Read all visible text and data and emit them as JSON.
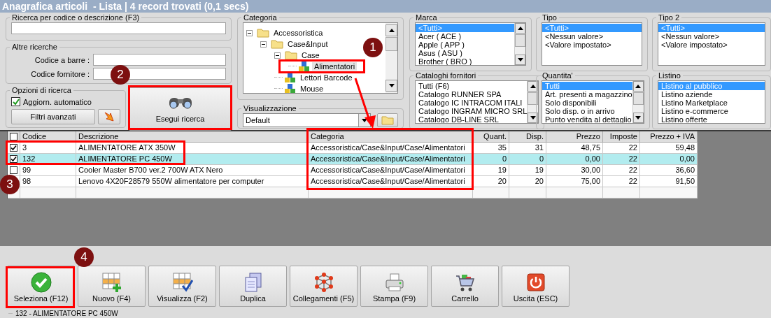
{
  "window": {
    "title": "Anagrafica articoli  - Lista | 4 record trovati (0,1 secs)"
  },
  "search": {
    "title": "Ricerca per codice o descrizione (F3)"
  },
  "other_searches": {
    "title": "Altre ricerche",
    "fields": [
      {
        "label": "Codice a barre :"
      },
      {
        "label": "Codice fornitore :"
      }
    ]
  },
  "options": {
    "title": "Opzioni di ricerca",
    "auto_update": {
      "label": "Aggiorn. automatico",
      "checked": true
    },
    "advanced_button": "Filtri avanzati"
  },
  "search_button": "Esegui ricerca",
  "category": {
    "title": "Categoria",
    "tree": [
      {
        "label": "Accessoristica",
        "kind": "folder",
        "expanded": true,
        "selected": false,
        "children": [
          {
            "label": "Case&Input",
            "kind": "folder",
            "expanded": true,
            "selected": false,
            "children": [
              {
                "label": "Case",
                "kind": "folder",
                "expanded": true,
                "selected": false,
                "children": [
                  {
                    "label": "Alimentatori",
                    "kind": "item",
                    "selected": true
                  }
                ]
              },
              {
                "label": "Lettori Barcode",
                "kind": "item",
                "selected": false
              },
              {
                "label": "Mouse",
                "kind": "item",
                "selected": false
              }
            ]
          }
        ]
      }
    ]
  },
  "view": {
    "title": "Visualizzazione",
    "value": "Default"
  },
  "lists": [
    {
      "title": "Marca",
      "scrollbar": true,
      "items": [
        {
          "label": "<Tutti>",
          "selected": true
        },
        {
          "label": "Acer ( ACE )",
          "selected": false
        },
        {
          "label": "Apple ( APP )",
          "selected": false
        },
        {
          "label": "Asus ( ASU )",
          "selected": false
        },
        {
          "label": "Brother ( BRO )",
          "selected": false
        }
      ]
    },
    {
      "title": "Tipo",
      "scrollbar": false,
      "items": [
        {
          "label": "<Tutti>",
          "selected": true
        },
        {
          "label": "<Nessun valore>",
          "selected": false
        },
        {
          "label": "<Valore impostato>",
          "selected": false
        }
      ]
    },
    {
      "title": "Tipo 2",
      "scrollbar": false,
      "items": [
        {
          "label": "<Tutti>",
          "selected": true
        },
        {
          "label": "<Nessun valore>",
          "selected": false
        },
        {
          "label": "<Valore impostato>",
          "selected": false
        }
      ]
    },
    {
      "title": "Cataloghi fornitori",
      "scrollbar": true,
      "items": [
        {
          "label": "Tutti (F6)",
          "selected": false
        },
        {
          "label": "Catalogo RUNNER SPA",
          "selected": false
        },
        {
          "label": "Catalogo IC INTRACOM ITALI",
          "selected": false
        },
        {
          "label": "Catalogo INGRAM MICRO SRL",
          "selected": false
        },
        {
          "label": "Catalogo DB-LINE SRL",
          "selected": false
        }
      ]
    },
    {
      "title": "Quantita'",
      "scrollbar": true,
      "items": [
        {
          "label": "Tutti",
          "selected": true
        },
        {
          "label": "Art. presenti a magazzino",
          "selected": false
        },
        {
          "label": "Solo disponibili",
          "selected": false
        },
        {
          "label": "Solo disp. o in arrivo",
          "selected": false
        },
        {
          "label": "Punto vendita al dettaglio",
          "selected": false
        }
      ]
    },
    {
      "title": "Listino",
      "scrollbar": false,
      "items": [
        {
          "label": "Listino al pubblico",
          "selected": true
        },
        {
          "label": "Listino aziende",
          "selected": false
        },
        {
          "label": "Listino Marketplace",
          "selected": false
        },
        {
          "label": "Listino e-commerce",
          "selected": false
        },
        {
          "label": "Listino offerte",
          "selected": false
        }
      ]
    }
  ],
  "table": {
    "header_checked": false,
    "columns": [
      {
        "label": "Codice",
        "kind": "text"
      },
      {
        "label": "Descrizione",
        "kind": "text"
      },
      {
        "label": "Categoria",
        "kind": "text"
      },
      {
        "label": "Quant.",
        "kind": "number"
      },
      {
        "label": "Disp.",
        "kind": "number"
      },
      {
        "label": "Prezzo",
        "kind": "number"
      },
      {
        "label": "Imposte",
        "kind": "number"
      },
      {
        "label": "Prezzo + IVA",
        "kind": "number"
      }
    ],
    "rows": [
      {
        "checked": true,
        "selected": false,
        "cells": [
          "3",
          "ALIMENTATORE ATX 350W",
          "Accessoristica/Case&Input/Case/Alimentatori",
          "35",
          "31",
          "48,75",
          "22",
          "59,48"
        ]
      },
      {
        "checked": true,
        "selected": true,
        "cells": [
          "132",
          "ALIMENTATORE PC 450W",
          "Accessoristica/Case&Input/Case/Alimentatori",
          "0",
          "0",
          "0,00",
          "22",
          "0,00"
        ]
      },
      {
        "checked": false,
        "selected": false,
        "cells": [
          "99",
          "Cooler Master B700 ver.2 700W ATX Nero",
          "Accessoristica/Case&Input/Case/Alimentatori",
          "19",
          "19",
          "30,00",
          "22",
          "36,60"
        ]
      },
      {
        "selected": false,
        "cells": [
          "98",
          "Lenovo 4X20F28579 550W alimentatore per computer",
          "Accessoristica/Case&Input/Case/Alimentatori",
          "20",
          "20",
          "75,00",
          "22",
          "91,50"
        ]
      }
    ]
  },
  "toolbar": [
    {
      "label": "Seleziona (F12)",
      "kind": "check"
    },
    {
      "label": "Nuovo (F4)",
      "kind": "grid-add"
    },
    {
      "label": "Visualizza (F2)",
      "kind": "grid-check"
    },
    {
      "label": "Duplica",
      "kind": "copy"
    },
    {
      "label": "Collegamenti (F5)",
      "kind": "network"
    },
    {
      "label": "Stampa (F9)",
      "kind": "printer"
    },
    {
      "label": "Carrello",
      "kind": "cart"
    },
    {
      "label": "Uscita (ESC)",
      "kind": "power"
    }
  ],
  "status_bar": "132 - ALIMENTATORE PC 450W",
  "callouts": [
    {
      "label": "1"
    },
    {
      "label": "2"
    },
    {
      "label": "3"
    },
    {
      "label": "4"
    }
  ]
}
